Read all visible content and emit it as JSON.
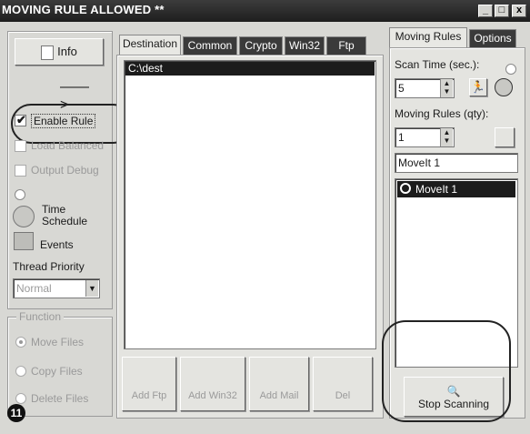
{
  "window": {
    "title": "MOVING RULE ALLOWED **",
    "minimize": "_",
    "restore": "□",
    "close": "x"
  },
  "left": {
    "info_label": "Info",
    "arrow": "——>",
    "enable_rule": "Enable Rule",
    "load_balanced": "Load Balanced",
    "output_debug": "Output Debug",
    "time_schedule_line1": "Time",
    "time_schedule_line2": "Schedule",
    "events": "Events",
    "thread_priority_label": "Thread Priority",
    "thread_priority_value": "Normal",
    "function_legend": "Function",
    "move_files": "Move Files",
    "copy_files": "Copy Files",
    "delete_files": "Delete Files",
    "callout_number": "11"
  },
  "center": {
    "tabs": [
      "Destination",
      "Common",
      "Crypto",
      "Win32",
      "Ftp"
    ],
    "destinations": [
      "C:\\dest"
    ],
    "buttons": [
      "Add Ftp",
      "Add Win32",
      "Add Mail",
      "Del"
    ]
  },
  "right": {
    "tabs": [
      "Moving Rules",
      "Options"
    ],
    "scan_time_label": "Scan Time (sec.):",
    "scan_time_value": "5",
    "moving_rules_label": "Moving Rules (qty):",
    "moving_rules_qty": "1",
    "rule_name_value": "MoveIt 1",
    "rules": [
      "MoveIt 1"
    ],
    "stop_scanning": "Stop Scanning"
  }
}
